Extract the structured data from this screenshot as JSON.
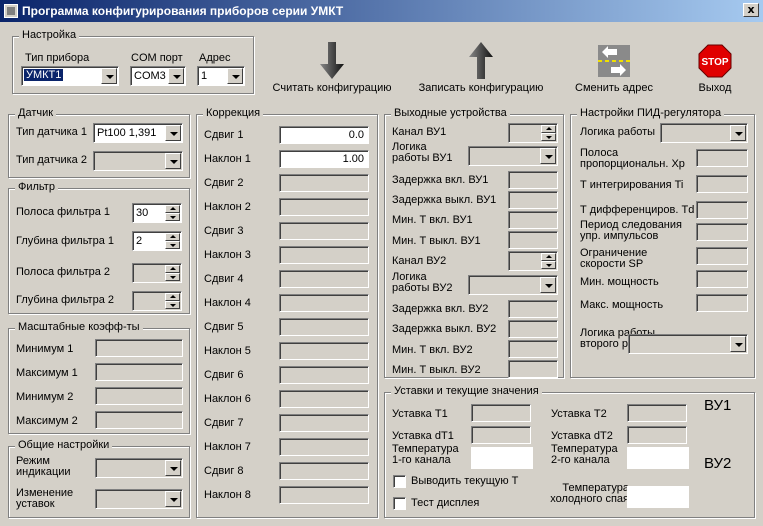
{
  "window": {
    "title": "Программа конфигурирования приборов серии УМКТ",
    "close": "x"
  },
  "settings": {
    "legend": "Настройка",
    "device_type_label": "Тип прибора",
    "device_type_value": "УМКТ1",
    "com_label": "COM порт",
    "com_value": "COM3",
    "addr_label": "Адрес",
    "addr_value": "1"
  },
  "toolbar": {
    "read": "Считать конфигурацию",
    "write": "Записать конфигурацию",
    "change_addr": "Сменить адрес",
    "exit": "Выход",
    "stop_text": "STOP"
  },
  "sensor": {
    "legend": "Датчик",
    "type1_label": "Тип датчика 1",
    "type1_value": "Pt100 1,391",
    "type2_label": "Тип датчика 2"
  },
  "filter": {
    "legend": "Фильтр",
    "band1_label": "Полоса фильтра 1",
    "band1_value": "30",
    "depth1_label": "Глубина фильтра 1",
    "depth1_value": "2",
    "band2_label": "Полоса фильтра 2",
    "depth2_label": "Глубина фильтра 2"
  },
  "scale": {
    "legend": "Масштабные коэфф-ты",
    "min1": "Минимум 1",
    "max1": "Максимум 1",
    "min2": "Минимум 2",
    "max2": "Максимум 2"
  },
  "general": {
    "legend": "Общие настройки",
    "mode_label": "Режим индикации",
    "change_label": "Изменение уставок"
  },
  "correction": {
    "legend": "Коррекция",
    "rows": [
      {
        "label": "Сдвиг 1",
        "value": "0.0"
      },
      {
        "label": "Наклон 1",
        "value": "1.00"
      },
      {
        "label": "Сдвиг 2",
        "value": ""
      },
      {
        "label": "Наклон 2",
        "value": ""
      },
      {
        "label": "Сдвиг 3",
        "value": ""
      },
      {
        "label": "Наклон 3",
        "value": ""
      },
      {
        "label": "Сдвиг 4",
        "value": ""
      },
      {
        "label": "Наклон 4",
        "value": ""
      },
      {
        "label": "Сдвиг 5",
        "value": ""
      },
      {
        "label": "Наклон 5",
        "value": ""
      },
      {
        "label": "Сдвиг 6",
        "value": ""
      },
      {
        "label": "Наклон 6",
        "value": ""
      },
      {
        "label": "Сдвиг 7",
        "value": ""
      },
      {
        "label": "Наклон 7",
        "value": ""
      },
      {
        "label": "Сдвиг 8",
        "value": ""
      },
      {
        "label": "Наклон 8",
        "value": ""
      }
    ]
  },
  "outputs": {
    "legend": "Выходные устройства",
    "ch1": "Канал ВУ1",
    "logic1": "Логика работы ВУ1",
    "on_delay1": "Задержка вкл. ВУ1",
    "off_delay1": "Задержка выкл. ВУ1",
    "min_on1": "Мин. Т вкл. ВУ1",
    "min_off1": "Мин. Т выкл. ВУ1",
    "ch2": "Канал ВУ2",
    "logic2": "Логика работы ВУ2",
    "on_delay2": "Задержка вкл. ВУ2",
    "off_delay2": "Задержка выкл. ВУ2",
    "min_on2": "Мин. Т вкл. ВУ2",
    "min_off2": "Мин. Т выкл. ВУ2"
  },
  "pid": {
    "legend": "Настройки ПИД-регулятора",
    "logic": "Логика работы",
    "xp": "Полоса пропорциональн. Хр",
    "ti": "Т интегрирования Ti",
    "td": "Т дифференциров. Td",
    "period": "Период следования упр. импульсов",
    "sp_limit": "Ограничение скорости SP",
    "min_power": "Мин. мощность",
    "max_power": "Макс. мощность",
    "relay2_logic": "Логика работы второго реле"
  },
  "setpoints": {
    "legend": "Уставки и текущие значения",
    "sp_t1": "Уставка Т1",
    "sp_dt1": "Уставка dT1",
    "sp_t2": "Уставка Т2",
    "sp_dt2": "Уставка dT2",
    "temp1": "Температура 1-го канала",
    "temp2": "Температура 2-го канала",
    "cold": "Температура холодного спая",
    "show_current": "Выводить текущую Т",
    "display_test": "Тест дисплея",
    "vu1": "ВУ1",
    "vu2": "ВУ2"
  }
}
